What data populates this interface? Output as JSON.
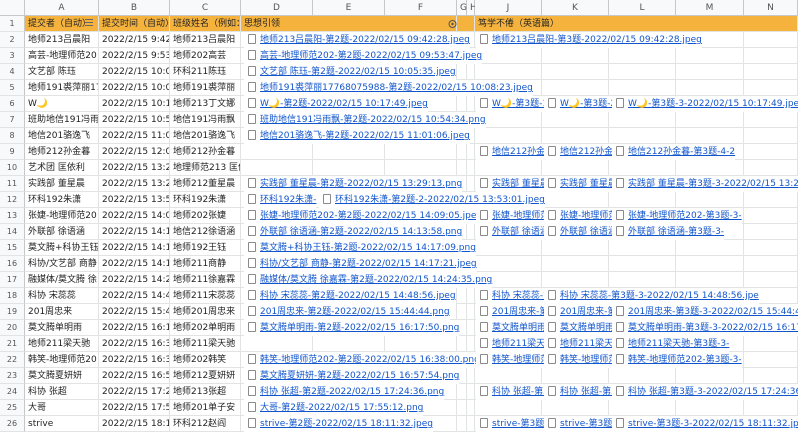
{
  "columns": [
    "A",
    "B",
    "C",
    "D",
    "E",
    "F",
    "G",
    "H",
    "I",
    "J",
    "K",
    "L",
    "M",
    "N"
  ],
  "header_row": {
    "num": "1",
    "a": "提交者（自动）",
    "b": "提交时间（自动）",
    "c": "班级姓名（例如：",
    "d": "思想引领",
    "i": "笃学不倦（英语篇）"
  },
  "rows": [
    {
      "num": "2",
      "a": "地师213吕晨阳",
      "b": "2022/2/15 9:42:28",
      "c": "地师213吕晨阳",
      "d": "地师213吕晨阳-第2题-2022/02/15 09:42:28.jpeg",
      "i": "地师213吕晨阳-第3题-2022/02/15 09:42:28.jpeg"
    },
    {
      "num": "3",
      "a": "高芸-地理师范20",
      "b": "2022/2/15 9:53:47",
      "c": "地师202高芸",
      "d": "高芸-地理师范202-第2题-2022/02/15 09:53:47.jpeg"
    },
    {
      "num": "4",
      "a": "文艺部 陈珏",
      "b": "2022/2/15 10:05:35",
      "c": "环科211陈珏",
      "d": "文艺部 陈珏-第2题-2022/02/15 10:05:35.jpeg"
    },
    {
      "num": "5",
      "a": "地师191裘萍丽17",
      "b": "2022/2/15 10:08:23",
      "c": "地师191裘萍丽",
      "d": "地师191裘萍丽17768075988-第2题-2022/02/15 10:08:23.jpeg"
    },
    {
      "num": "6",
      "a": "W🌙",
      "b": "2022/2/15 10:17:49",
      "c": "地师213丁文娜",
      "d": "W🌙-第2题-2022/02/15 10:17:49.jpeg",
      "i": "W🌙-第3题-1-",
      "k": "W🌙-第3题-2-",
      "m": "W🌙-第3题-3-2022/02/15 10:17:49.jpeg"
    },
    {
      "num": "7",
      "a": "班助地信191冯雨",
      "b": "2022/2/15 10:54:34",
      "c": "地信191冯雨飘",
      "d": "班助地信191冯雨飘-第2题-2022/02/15 10:54:34.png"
    },
    {
      "num": "8",
      "a": "地信201骆逸飞",
      "b": "2022/2/15 11:01:06",
      "c": "地信201骆逸飞",
      "d": "地信201骆逸飞-第2题-2022/02/15 11:01:06.jpeg"
    },
    {
      "num": "9",
      "a": "地师212孙金暮",
      "b": "2022/2/15 12:01:44",
      "c": "地师212孙金暮",
      "i": "地信212孙金暮",
      "k": "地信212孙金暮",
      "m": "地信212孙金暮-第3题-4-2"
    },
    {
      "num": "10",
      "a": "艺术团 匡依利",
      "b": "2022/2/15 13:24:52",
      "c": "地理师范213 匡依利"
    },
    {
      "num": "11",
      "a": "实践部 董星晨",
      "b": "2022/2/15 13:29:13",
      "c": "地师212董星晨",
      "d": "实践部 董星晨-第2题-2022/02/15 13:29:13.png",
      "i": "实践部 董星晨",
      "k": "实践部 董星晨",
      "m": "实践部 董星晨-第3题-3-2022/02/15 13:29:1"
    },
    {
      "num": "12",
      "a": "环科192朱潇",
      "b": "2022/2/15 13:53:01",
      "c": "环科192朱潇",
      "d": "环科192朱潇-",
      "f": "环科192朱潇-第2题-2-2022/02/15 13:53:01.jpeg"
    },
    {
      "num": "13",
      "a": "张婕-地理师范20",
      "b": "2022/2/15 14:09:05",
      "c": "地师202张婕",
      "d": "张婕-地理师范202-第2题-2022/02/15 14:09:05.jpeg",
      "i": "张婕-地理师范",
      "k": "张婕-地理师范",
      "m": "张婕-地理师范202-第3题-3-"
    },
    {
      "num": "14",
      "a": "外联部 徐语涵",
      "b": "2022/2/15 14:13:58",
      "c": "地信212徐语涵",
      "d": "外联部 徐语涵-第2题-2022/02/15 14:13:58.png",
      "i": "外联部 徐语涵",
      "k": "外联部 徐语涵",
      "m": "外联部 徐语涵-第3题-3-"
    },
    {
      "num": "15",
      "a": "莫文腾+科协王钰",
      "b": "2022/2/15 14:17:09",
      "c": "地师192王钰",
      "d": "莫文腾+科协王钰-第2题-2022/02/15 14:17:09.png"
    },
    {
      "num": "16",
      "a": "科协/文艺部 商静",
      "b": "2022/2/15 14:17:21",
      "c": "地师211商静",
      "d": "科协/文艺部 商静-第2题-2022/02/15 14:17:21.jpeg"
    },
    {
      "num": "17",
      "a": "融媒体/莫文腾 徐",
      "b": "2022/2/15 14:24:35",
      "c": "地师211徐嘉霖",
      "d": "融媒体/莫文腾 徐嘉霖-第2题-2022/02/15 14:24:35.png"
    },
    {
      "num": "18",
      "a": "科协 宋蕊蕊",
      "b": "2022/2/15 14:48:56",
      "c": "地师211宋蕊蕊",
      "d": "科协 宋蕊蕊-第2题-2022/02/15 14:48:56.jpeg",
      "i": "科协 宋蕊蕊-第",
      "k": "科协 宋蕊蕊-第3题-3-2022/02/15 14:48:56.jpe"
    },
    {
      "num": "19",
      "a": "201周忠来",
      "b": "2022/2/15 15:44:44",
      "c": "地师201周忠来",
      "d": "201周忠来-第2题-2022/02/15 15:44:44.png",
      "i": "201周忠来-第3",
      "k": "201周忠来-第3",
      "m": "201周忠来-第3题-3-2022/02/15 15:44:44.jp"
    },
    {
      "num": "20",
      "a": "莫文腾单明雨",
      "b": "2022/2/15 16:17:50",
      "c": "地师202单明雨",
      "d": "莫文腾单明雨-第2题-2022/02/15 16:17:50.png",
      "i": "莫文腾单明雨",
      "k": "莫文腾单明雨",
      "m": "莫文腾单明雨-第3题-3-2022/02/15 16:17:50"
    },
    {
      "num": "21",
      "a": "地师211梁天驰",
      "b": "2022/2/15 16:36:30",
      "c": "地师211梁天驰",
      "i": "地师211梁天驰",
      "k": "地师211梁天驰",
      "m": "地师211梁天驰-第3题-3-"
    },
    {
      "num": "22",
      "a": "韩笑-地理师范20",
      "b": "2022/2/15 16:38:00",
      "c": "地师202韩笑",
      "d": "韩笑-地理师范202-第2题-2022/02/15 16:38:00.png",
      "i": "韩笑-地理师范",
      "k": "韩笑-地理师范",
      "m": "韩笑-地理师范202-第3题-3-"
    },
    {
      "num": "23",
      "a": "莫文腾夏妍妍",
      "b": "2022/2/15 16:57:54",
      "c": "地师212夏妍妍",
      "d": "莫文腾夏妍妍-第2题-2022/02/15 16:57:54.png"
    },
    {
      "num": "24",
      "a": "科协 张超",
      "b": "2022/2/15 17:24:36",
      "c": "地师213张超",
      "d": "科协 张超-第2题-2022/02/15 17:24:36.png",
      "i": "科协 张超-第3",
      "k": "科协 张超-第3",
      "m": "科协 张超-第3题-3-2022/02/15 17:24:36.pr"
    },
    {
      "num": "25",
      "a": "大哥",
      "b": "2022/2/15 17:55:12",
      "c": "地师201单子安",
      "d": "大哥-第2题-2022/02/15 17:55:12.png"
    },
    {
      "num": "26",
      "a": "strive",
      "b": "2022/2/15 18:11:32",
      "c": "环科212赵阎",
      "d": "strive-第2题-2022/02/15 18:11:32.jpeg",
      "i": "strive-第3题-1",
      "k": "strive-第3题-2",
      "m": "strive-第3题-3-2022/02/15 18:11:32.jpe"
    }
  ]
}
